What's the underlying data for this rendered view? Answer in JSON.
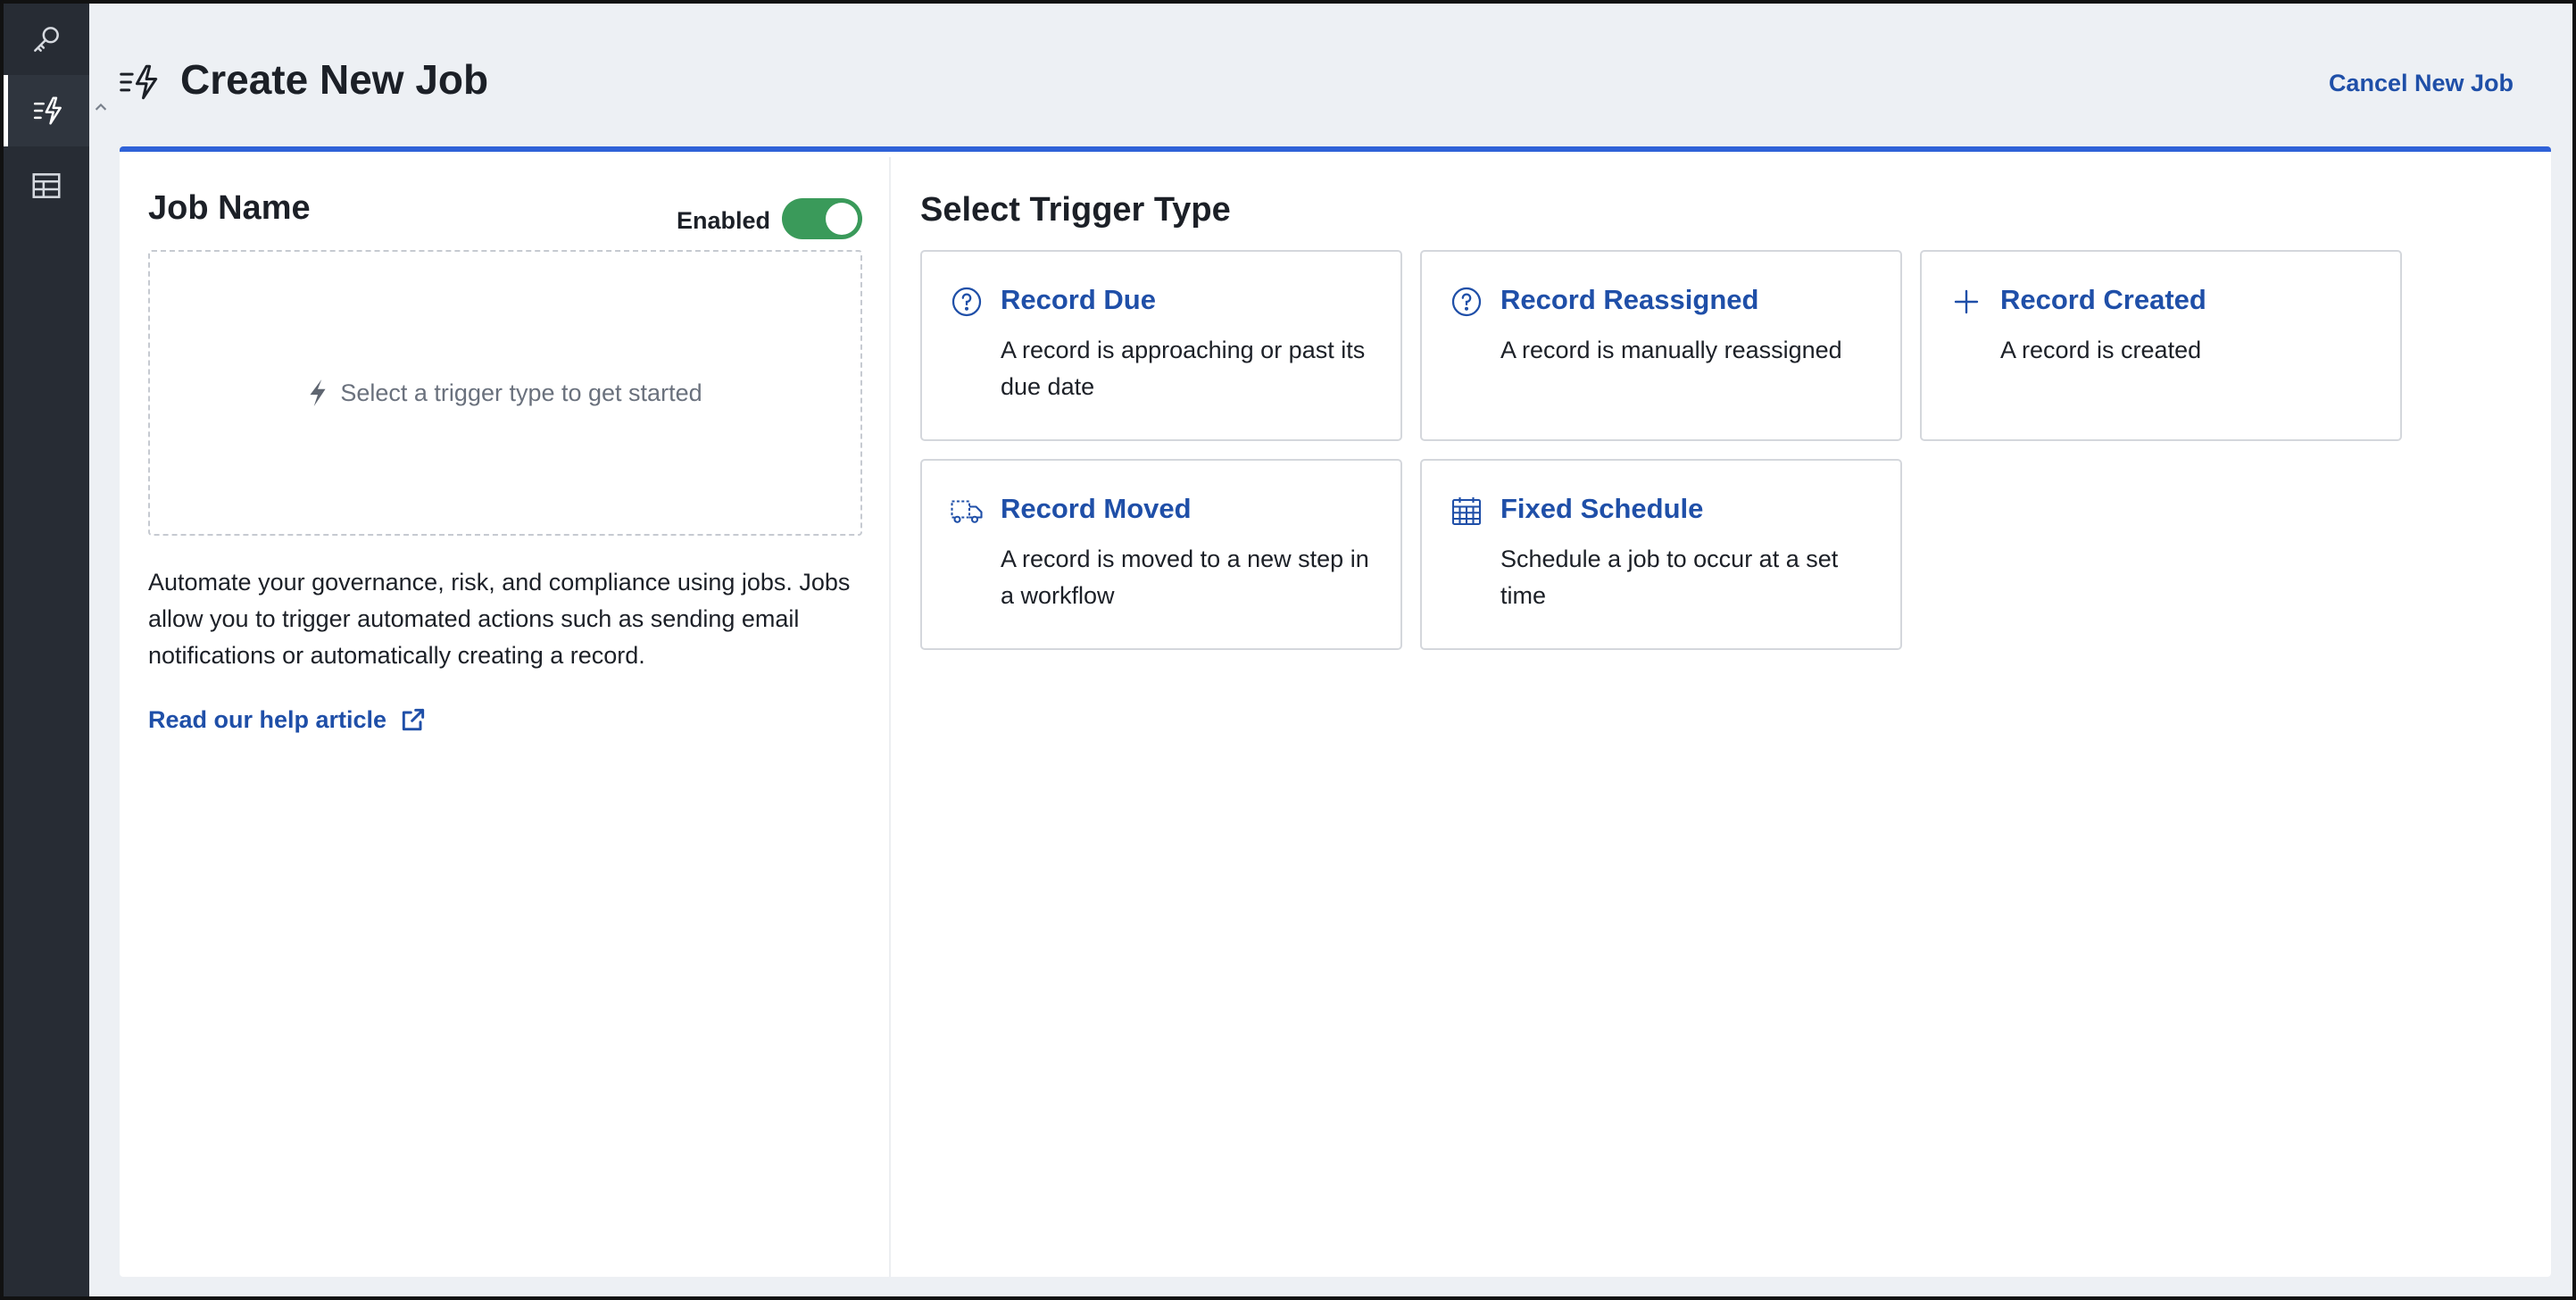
{
  "header": {
    "title": "Create New Job",
    "cancel_label": "Cancel New Job"
  },
  "sidebar": {
    "items": [
      {
        "icon": "key-icon"
      },
      {
        "icon": "jobs-icon",
        "active": true
      },
      {
        "icon": "table-icon"
      }
    ]
  },
  "left": {
    "job_name_label": "Job Name",
    "enabled_label": "Enabled",
    "enabled": true,
    "dropzone_text": "Select a trigger type to get started",
    "description": "Automate your governance, risk, and compliance using jobs. Jobs allow you to trigger automated actions such as sending email notifications or automatically creating a record.",
    "help_link": "Read our help article"
  },
  "right": {
    "title": "Select Trigger Type",
    "cards": [
      {
        "icon": "question-circle-icon",
        "title": "Record Due",
        "desc": "A record is approaching or past its due date"
      },
      {
        "icon": "question-circle-icon",
        "title": "Record Reassigned",
        "desc": "A record is manually reassigned"
      },
      {
        "icon": "plus-icon",
        "title": "Record Created",
        "desc": "A record is created"
      },
      {
        "icon": "truck-icon",
        "title": "Record Moved",
        "desc": "A record is moved to a new step in a workflow"
      },
      {
        "icon": "calendar-icon",
        "title": "Fixed Schedule",
        "desc": "Schedule a job to occur at a set time"
      }
    ]
  },
  "colors": {
    "accent": "#2f62d8",
    "link": "#1f4fa8",
    "toggle_on": "#3a9a5a",
    "sidebar_bg": "#272c34"
  }
}
